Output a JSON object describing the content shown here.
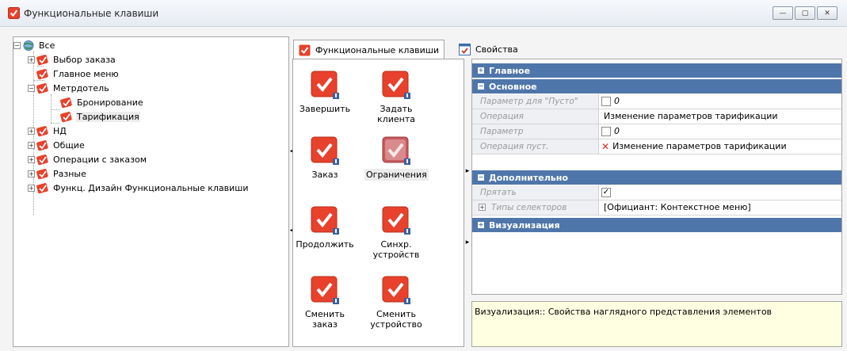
{
  "window": {
    "title": "Функциональные клавиши",
    "controls": [
      "—",
      "▢",
      "✕"
    ]
  },
  "tree": {
    "root": "Все",
    "items": [
      {
        "label": "Выбор заказа",
        "expander": "+"
      },
      {
        "label": "Главное меню",
        "expander": ""
      },
      {
        "label": "Метрдотель",
        "expander": "−"
      },
      {
        "label": "Бронирование",
        "expander": ""
      },
      {
        "label": "Тарификация",
        "expander": ""
      },
      {
        "label": "НД",
        "expander": "+"
      },
      {
        "label": "Общие",
        "expander": "+"
      },
      {
        "label": "Операции с заказом",
        "expander": "+"
      },
      {
        "label": "Разные",
        "expander": "+"
      },
      {
        "label": "Функц. Дизайн Функциональные клавиши",
        "expander": "+"
      }
    ],
    "selected": "Тарификация"
  },
  "tabs": {
    "function_keys": "Функциональные клавиши",
    "properties": "Свойства"
  },
  "function_keys": [
    {
      "line1": "Завершить",
      "line2": ""
    },
    {
      "line1": "Задать",
      "line2": "клиента"
    },
    {
      "line1": "Заказ",
      "line2": ""
    },
    {
      "line1": "Ограничения",
      "line2": ""
    },
    {
      "line1": "Продолжить",
      "line2": ""
    },
    {
      "line1": "Синхр.",
      "line2": "устройств"
    },
    {
      "line1": "Сменить",
      "line2": "заказ"
    },
    {
      "line1": "Сменить",
      "line2": "устройство"
    }
  ],
  "properties": {
    "cat_main": "Главное",
    "cat_basic": "Основное",
    "param_empty_label": "Параметр для \"Пусто\"",
    "param_empty_value": "0",
    "operation_label": "Операция",
    "operation_value": "Изменение параметров тарификации",
    "param_label": "Параметр",
    "param_value": "0",
    "operation_empty_label": "Операция пуст.",
    "operation_empty_value": "Изменение параметров тарификации",
    "cat_extra": "Дополнительно",
    "hide_label": "Прятать",
    "hide_checked": "✓",
    "selector_types_label": "Типы селекторов",
    "selector_types_value": "[Официант: Контекстное меню]",
    "cat_visual": "Визуализация"
  },
  "description": "Визуализация:: Свойства наглядного представления элементов",
  "colors": {
    "category_bar": "#4f76aa",
    "key_red": "#e8412c",
    "key_disabled": "#c85a5e",
    "description_bg": "#ffffe1"
  }
}
